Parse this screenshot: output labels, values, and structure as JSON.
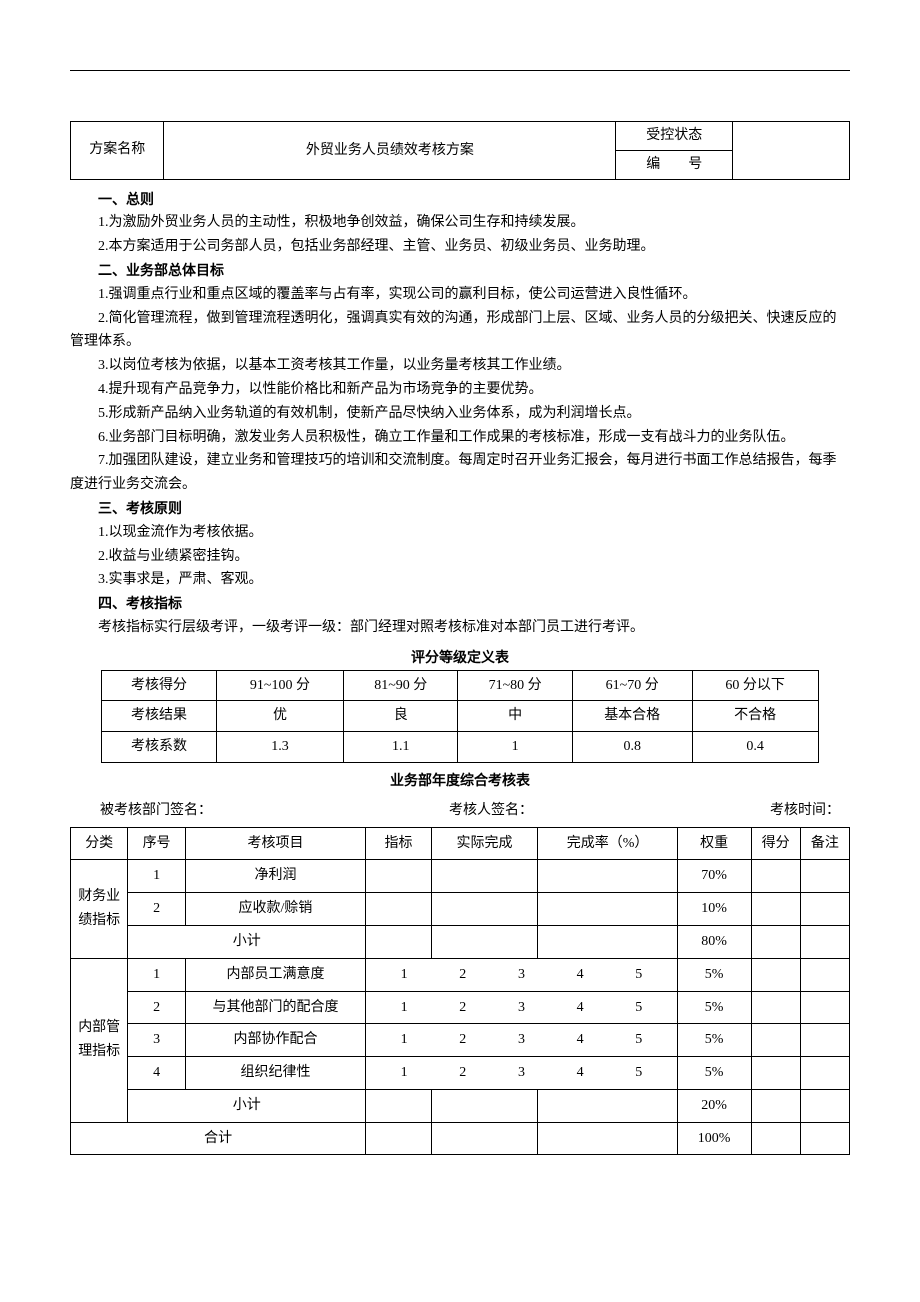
{
  "header": {
    "label_plan_name": "方案名称",
    "plan_title": "外贸业务人员绩效考核方案",
    "label_control_status": "受控状态",
    "label_number": "编　　号"
  },
  "sections": {
    "s1_title": "一、总则",
    "s1_p1": "1.为激励外贸业务人员的主动性，积极地争创效益，确保公司生存和持续发展。",
    "s1_p2": "2.本方案适用于公司务部人员，包括业务部经理、主管、业务员、初级业务员、业务助理。",
    "s2_title": "二、业务部总体目标",
    "s2_p1": "1.强调重点行业和重点区域的覆盖率与占有率，实现公司的赢利目标，使公司运营进入良性循环。",
    "s2_p2": "2.简化管理流程，做到管理流程透明化，强调真实有效的沟通，形成部门上层、区域、业务人员的分级把关、快速反应的管理体系。",
    "s2_p3": "3.以岗位考核为依据，以基本工资考核其工作量，以业务量考核其工作业绩。",
    "s2_p4": "4.提升现有产品竞争力，以性能价格比和新产品为市场竞争的主要优势。",
    "s2_p5": "5.形成新产品纳入业务轨道的有效机制，使新产品尽快纳入业务体系，成为利润增长点。",
    "s2_p6": "6.业务部门目标明确，激发业务人员积极性，确立工作量和工作成果的考核标准，形成一支有战斗力的业务队伍。",
    "s2_p7": "7.加强团队建设，建立业务和管理技巧的培训和交流制度。每周定时召开业务汇报会，每月进行书面工作总结报告，每季度进行业务交流会。",
    "s3_title": "三、考核原则",
    "s3_p1": "1.以现金流作为考核依据。",
    "s3_p2": "2.收益与业绩紧密挂钩。",
    "s3_p3": "3.实事求是，严肃、客观。",
    "s4_title": "四、考核指标",
    "s4_p1": "考核指标实行层级考评，一级考评一级：部门经理对照考核标准对本部门员工进行考评。"
  },
  "grade_table": {
    "title": "评分等级定义表",
    "rows": {
      "r1_label": "考核得分",
      "r1": [
        "91~100 分",
        "81~90 分",
        "71~80 分",
        "61~70 分",
        "60 分以下"
      ],
      "r2_label": "考核结果",
      "r2": [
        "优",
        "良",
        "中",
        "基本合格",
        "不合格"
      ],
      "r3_label": "考核系数",
      "r3": [
        "1.3",
        "1.1",
        "1",
        "0.8",
        "0.4"
      ]
    }
  },
  "annual": {
    "title": "业务部年度综合考核表",
    "sig_dept": "被考核部门签名：",
    "sig_assessor": "考核人签名：",
    "sig_time": "考核时间：",
    "headers": {
      "category": "分类",
      "seq": "序号",
      "item": "考核项目",
      "indicator": "指标",
      "actual": "实际完成",
      "rate": "完成率（%）",
      "weight": "权重",
      "score": "得分",
      "remark": "备注"
    },
    "cat1_label": "财务业绩指标",
    "cat1": [
      {
        "seq": "1",
        "item": "净利润",
        "weight": "70%"
      },
      {
        "seq": "2",
        "item": "应收款/赊销",
        "weight": "10%"
      }
    ],
    "cat1_subtotal_label": "小计",
    "cat1_subtotal_weight": "80%",
    "cat2_label": "内部管理指标",
    "scale": [
      "1",
      "2",
      "3",
      "4",
      "5"
    ],
    "cat2": [
      {
        "seq": "1",
        "item": "内部员工满意度",
        "weight": "5%"
      },
      {
        "seq": "2",
        "item": "与其他部门的配合度",
        "weight": "5%"
      },
      {
        "seq": "3",
        "item": "内部协作配合",
        "weight": "5%"
      },
      {
        "seq": "4",
        "item": "组织纪律性",
        "weight": "5%"
      }
    ],
    "cat2_subtotal_label": "小计",
    "cat2_subtotal_weight": "20%",
    "total_label": "合计",
    "total_weight": "100%"
  }
}
